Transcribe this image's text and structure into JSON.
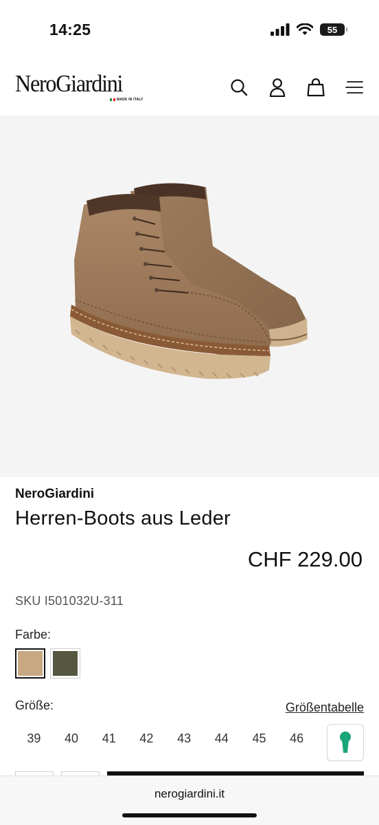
{
  "status": {
    "time": "14:25",
    "battery": "55"
  },
  "header": {
    "logo": "NeroGiardini",
    "logo_tag": "MADE IN ITALY",
    "icons": [
      "search-icon",
      "account-icon",
      "bag-icon",
      "menu-icon"
    ]
  },
  "product": {
    "brand": "NeroGiardini",
    "title": "Herren-Boots aus Leder",
    "price": "CHF 229.00",
    "sku": "SKU I501032U-311",
    "color_label": "Farbe:",
    "colors": [
      {
        "hex": "#c7a882",
        "selected": true
      },
      {
        "hex": "#575640",
        "selected": false
      }
    ],
    "size_label": "Größe:",
    "size_table_link": "Größentabelle",
    "sizes": [
      "39",
      "40",
      "41",
      "42",
      "43",
      "44",
      "45",
      "46"
    ]
  },
  "browser": {
    "url": "nerogiardini.it"
  },
  "colors": {
    "accent_green": "#1aa67a",
    "text": "#111111",
    "image_bg": "#f4f4f4"
  }
}
